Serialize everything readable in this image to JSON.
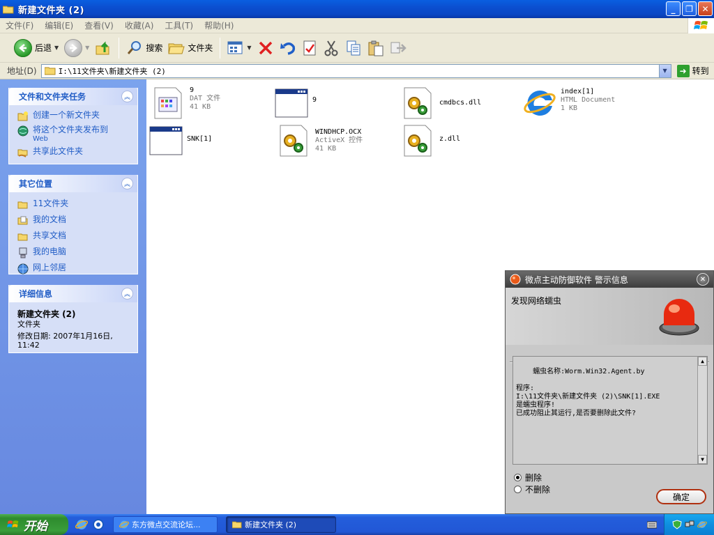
{
  "window": {
    "title": "新建文件夹 (2)"
  },
  "menu": {
    "items": [
      "文件(F)",
      "编辑(E)",
      "查看(V)",
      "收藏(A)",
      "工具(T)",
      "帮助(H)"
    ]
  },
  "toolbar": {
    "back_label": "后退",
    "search_label": "搜索",
    "folders_label": "文件夹"
  },
  "address": {
    "label": "地址(D)",
    "value": "I:\\11文件夹\\新建文件夹 (2)",
    "go_label": "转到"
  },
  "tasks_panel": {
    "title": "文件和文件夹任务",
    "items": [
      {
        "label": "创建一个新文件夹",
        "sub": ""
      },
      {
        "label": "将这个文件夹发布到",
        "sub": "Web"
      },
      {
        "label": "共享此文件夹",
        "sub": ""
      }
    ]
  },
  "places_panel": {
    "title": "其它位置",
    "items": [
      "11文件夹",
      "我的文档",
      "共享文档",
      "我的电脑",
      "网上邻居"
    ]
  },
  "details_panel": {
    "title": "详细信息",
    "name": "新建文件夹 (2)",
    "type": "文件夹",
    "modified": "修改日期: 2007年1月16日,",
    "modified_time": "11:42"
  },
  "files": [
    {
      "name": "9",
      "type": "DAT 文件",
      "size": "41 KB",
      "icon": "dat-file-icon"
    },
    {
      "name": "9",
      "type": "",
      "size": "",
      "icon": "window-file-icon"
    },
    {
      "name": "cmdbcs.dll",
      "type": "",
      "size": "",
      "icon": "dll-file-icon"
    },
    {
      "name": "index[1]",
      "type": "HTML Document",
      "size": "1 KB",
      "icon": "ie-html-icon"
    },
    {
      "name": "SNK[1]",
      "type": "",
      "size": "",
      "icon": "window-file-icon"
    },
    {
      "name": "WINDHCP.OCX",
      "type": "ActiveX 控件",
      "size": "41 KB",
      "icon": "dll-file-icon"
    },
    {
      "name": "z.dll",
      "type": "",
      "size": "",
      "icon": "dll-file-icon"
    }
  ],
  "alert": {
    "title": "微点主动防御软件  警示信息",
    "subject": "发现网络蠕虫",
    "message": "蠕虫名称:Worm.Win32.Agent.by\n\n程序:\nI:\\11文件夹\\新建文件夹 (2)\\SNK[1].EXE\n是蠕虫程序!\n已成功阻止其运行,是否要删除此文件?",
    "option_delete": "删除",
    "option_keep": "不删除",
    "ok_label": "确定"
  },
  "taskbar": {
    "start_label": "开始",
    "tasks": [
      "东方微点交流论坛...",
      "新建文件夹 (2)"
    ]
  },
  "colors": {
    "titlebar": "#0a4fd0",
    "taskpane": "#7ba3ed",
    "link": "#215dc6",
    "start": "#3a9d3a"
  }
}
